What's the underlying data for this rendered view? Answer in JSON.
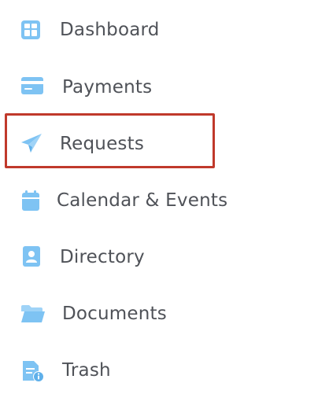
{
  "sidebar": {
    "items": [
      {
        "label": "Dashboard",
        "icon": "dashboard-icon"
      },
      {
        "label": "Payments",
        "icon": "credit-card-icon"
      },
      {
        "label": "Requests",
        "icon": "paper-plane-icon",
        "highlighted": true
      },
      {
        "label": "Calendar & Events",
        "icon": "calendar-icon"
      },
      {
        "label": "Directory",
        "icon": "contact-book-icon"
      },
      {
        "label": "Documents",
        "icon": "folder-icon"
      },
      {
        "label": "Trash",
        "icon": "document-info-icon"
      }
    ]
  },
  "colors": {
    "icon": "#7ec3f3",
    "label": "#4f5258",
    "highlight_border": "#c0392b",
    "background": "#ffffff"
  }
}
